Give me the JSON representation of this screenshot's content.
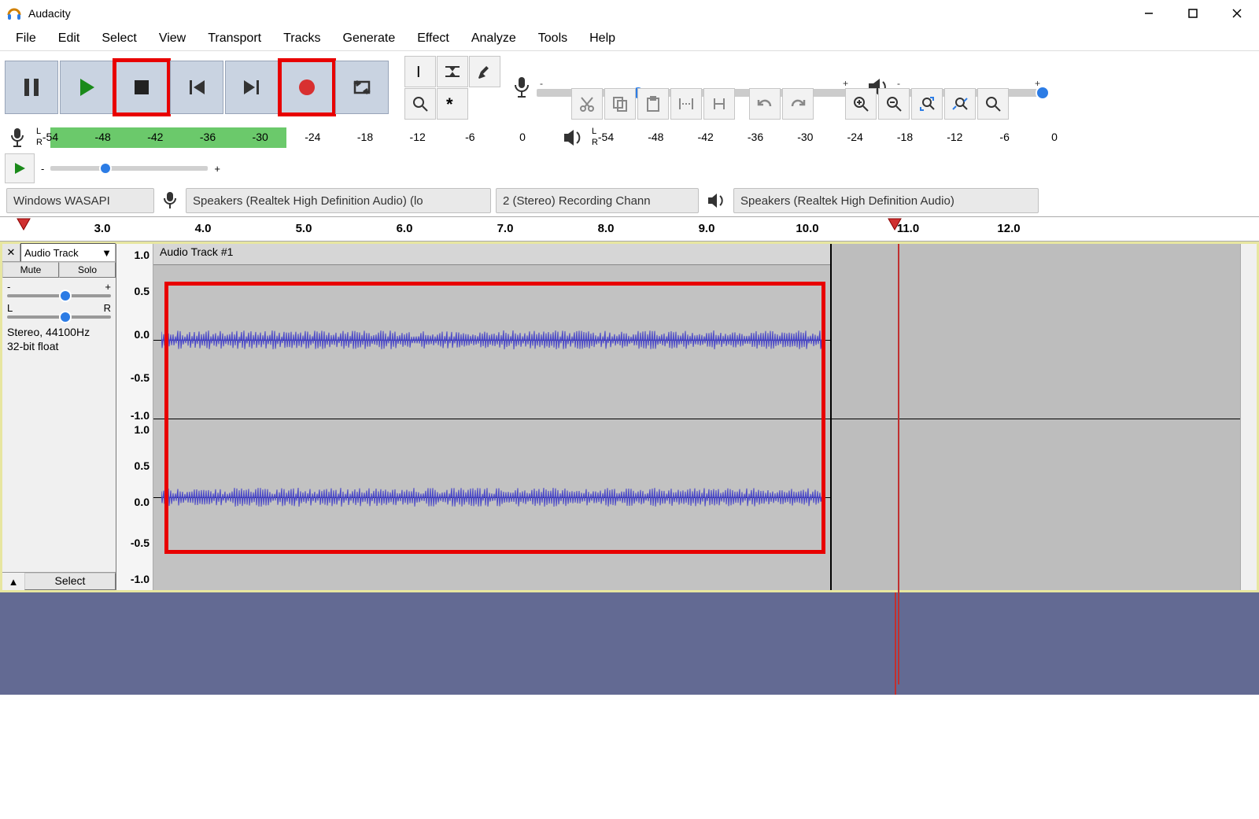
{
  "title": "Audacity",
  "menu": [
    "File",
    "Edit",
    "Select",
    "View",
    "Transport",
    "Tracks",
    "Generate",
    "Effect",
    "Analyze",
    "Tools",
    "Help"
  ],
  "meters": {
    "rec_ticks": [
      "-54",
      "-48",
      "-42",
      "-36",
      "-30",
      "-24",
      "-18",
      "-12",
      "-6",
      "0"
    ],
    "play_ticks": [
      "-54",
      "-48",
      "-42",
      "-36",
      "-30",
      "-24",
      "-18",
      "-12",
      "-6",
      "0"
    ]
  },
  "device": {
    "host": "Windows WASAPI",
    "rec_device": "Speakers (Realtek High Definition Audio) (lo",
    "rec_channels": "2 (Stereo) Recording Chann",
    "play_device": "Speakers (Realtek High Definition Audio)"
  },
  "ruler": [
    "3.0",
    "4.0",
    "5.0",
    "6.0",
    "7.0",
    "8.0",
    "9.0",
    "10.0",
    "11.0",
    "12.0"
  ],
  "track": {
    "dropdown_label": "Audio Track",
    "mute": "Mute",
    "solo": "Solo",
    "pan_left": "L",
    "pan_right": "R",
    "gain_minus": "-",
    "gain_plus": "+",
    "info1": "Stereo, 44100Hz",
    "info2": "32-bit float",
    "select": "Select",
    "clip_title": "Audio Track #1"
  },
  "amp_scale": [
    "1.0",
    "0.5",
    "0.0",
    "-0.5",
    "-1.0",
    "1.0",
    "0.5",
    "0.0",
    "-0.5",
    "-1.0"
  ],
  "playhead_time": "11.0"
}
